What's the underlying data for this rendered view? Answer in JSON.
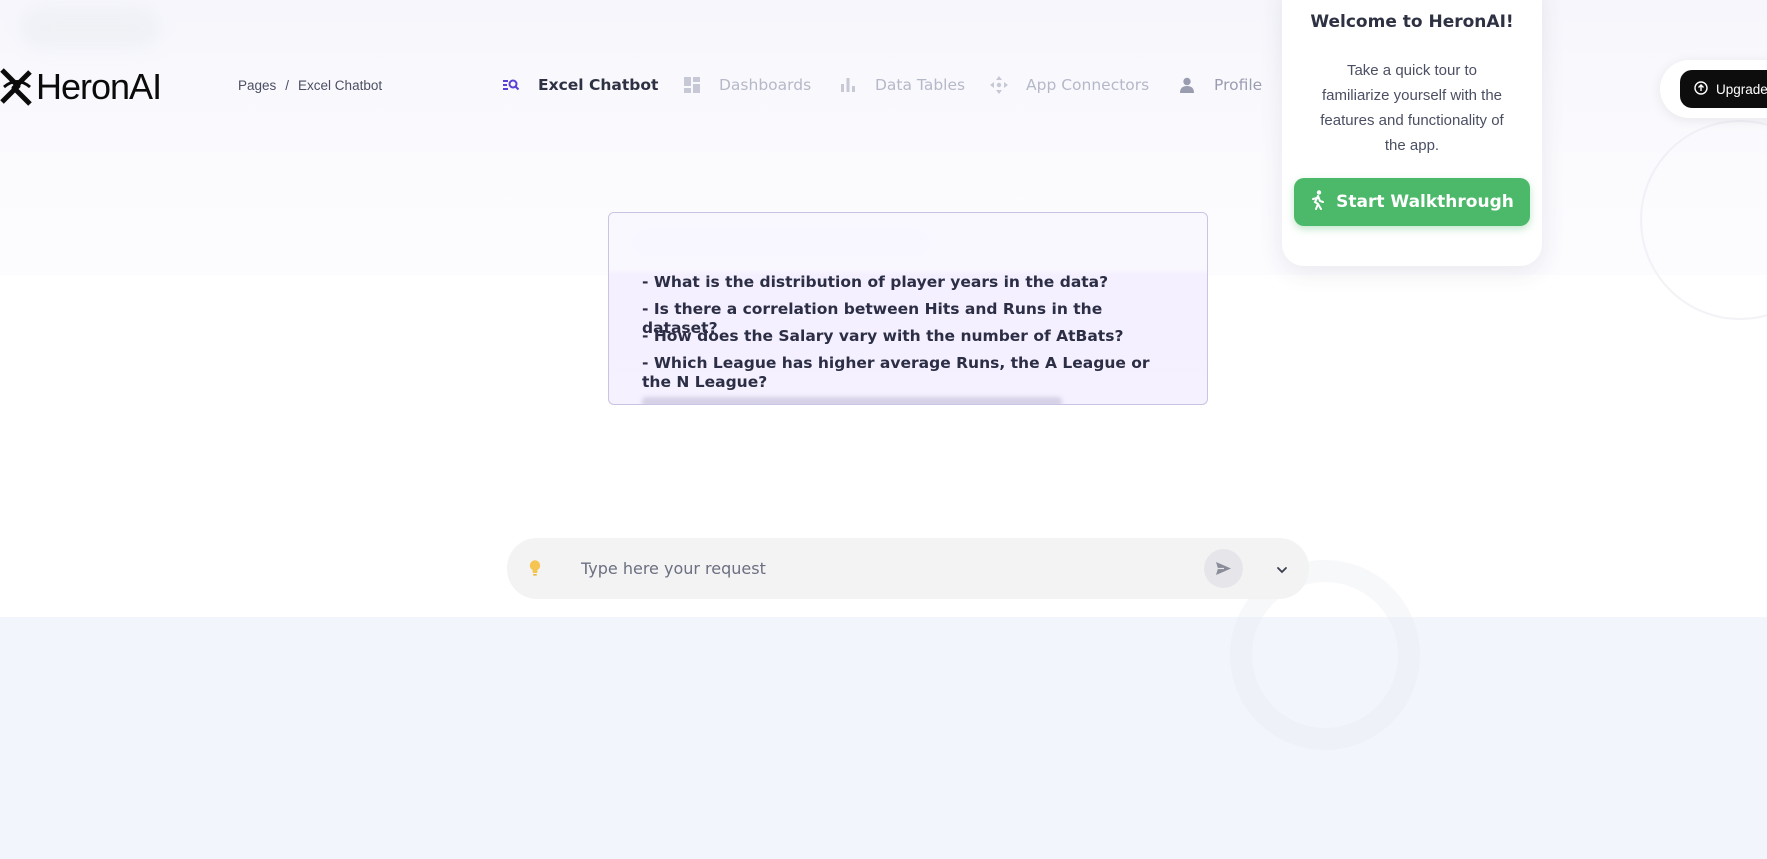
{
  "brand": {
    "name": "HeronAI"
  },
  "breadcrumb": {
    "root": "Pages",
    "separator": "/",
    "current": "Excel Chatbot"
  },
  "nav": {
    "items": [
      {
        "label": "Excel Chatbot",
        "icon": "chatbot-search-icon",
        "active": true
      },
      {
        "label": "Dashboards",
        "icon": "dashboard-grid-icon",
        "active": false
      },
      {
        "label": "Data Tables",
        "icon": "bar-chart-icon",
        "active": false
      },
      {
        "label": "App Connectors",
        "icon": "move-arrows-icon",
        "active": false
      },
      {
        "label": "Profile",
        "icon": "user-icon",
        "active": false
      }
    ]
  },
  "suggestions": {
    "questions": [
      "- What is the distribution of player years in the data?",
      "- Is there a correlation between Hits and Runs in the dataset?",
      "- How does the Salary vary with the number of AtBats?",
      "- Which League has higher average Runs, the A League or the N League?"
    ]
  },
  "tour": {
    "title": "Welcome to HeronAI!",
    "description": "Take a quick tour to familiarize yourself with the features and functionality of the app.",
    "button_label": "Start Walkthrough",
    "button_color": "#4cb86a"
  },
  "upgrade": {
    "label": "Upgrade"
  },
  "chat": {
    "placeholder": "Type here your request"
  },
  "colors": {
    "accent": "#5b3fd6",
    "bulb": "#f5c451",
    "active_nav": "#2d3142"
  }
}
